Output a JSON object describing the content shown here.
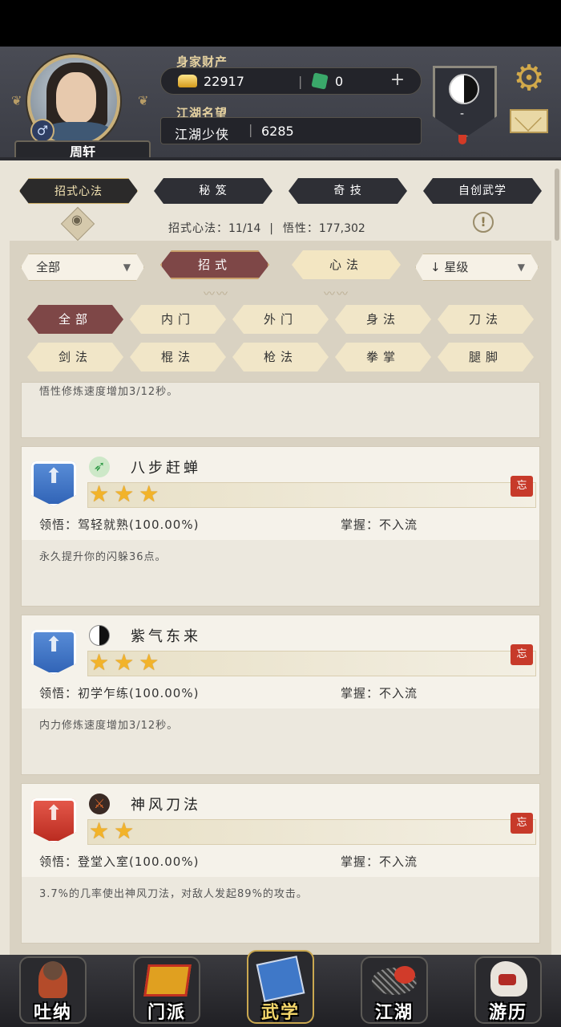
{
  "header": {
    "player_name": "周轩",
    "wealth_label": "身家财产",
    "gold": "22917",
    "jade": "0",
    "reputation_label": "江湖名望",
    "reputation_title": "江湖少侠",
    "reputation_value": "6285",
    "sect_value": "-",
    "gender_symbol": "♂"
  },
  "tabs": [
    {
      "label": "招式心法",
      "active": true
    },
    {
      "label": "秘 笈",
      "active": false
    },
    {
      "label": "奇 技",
      "active": false
    },
    {
      "label": "自创武学",
      "active": false
    }
  ],
  "stats": {
    "moves_label": "招式心法：",
    "moves_value": "11/14",
    "insight_label": "悟性：",
    "insight_value": "177,302"
  },
  "filters": {
    "category_dropdown": "全部",
    "pill_moves": "招式",
    "pill_heart": "心法",
    "sort_dropdown": "星级",
    "sort_arrow": "↓",
    "chips_row1": [
      "全部",
      "内门",
      "外门",
      "身法",
      "刀法"
    ],
    "chips_row2": [
      "剑法",
      "棍法",
      "枪法",
      "拳掌",
      "腿脚"
    ]
  },
  "skills": {
    "partial_desc": "悟性修炼速度增加3/12秒。",
    "comprehension_label": "领悟：",
    "mastery_label": "掌握：",
    "forget_label": "忘",
    "items": [
      {
        "name": "八步赶蝉",
        "stars": "★★★",
        "comprehension": "驾轻就熟(100.00%)",
        "mastery": "不入流",
        "desc": "永久提升你的闪躲36点。",
        "rank_color": "blue"
      },
      {
        "name": "紫气东来",
        "stars": "★★★",
        "comprehension": "初学乍练(100.00%)",
        "mastery": "不入流",
        "desc": "内力修炼速度增加3/12秒。",
        "rank_color": "blue"
      },
      {
        "name": "神风刀法",
        "stars": "★★",
        "comprehension": "登堂入室(100.00%)",
        "mastery": "不入流",
        "desc": "3.7%的几率使出神风刀法，对敌人发起89%的攻击。",
        "rank_color": "red"
      }
    ]
  },
  "bottom_nav": [
    {
      "label": "吐纳",
      "active": false
    },
    {
      "label": "门派",
      "active": false
    },
    {
      "label": "武学",
      "active": true
    },
    {
      "label": "江湖",
      "active": false
    },
    {
      "label": "游历",
      "active": false
    }
  ],
  "colors": {
    "accent_maroon": "#7e4747",
    "panel_bg": "#e9e4d8",
    "star_gold": "#f2b32a",
    "rank_blue": "#3f74c8",
    "rank_red": "#d0392c"
  }
}
